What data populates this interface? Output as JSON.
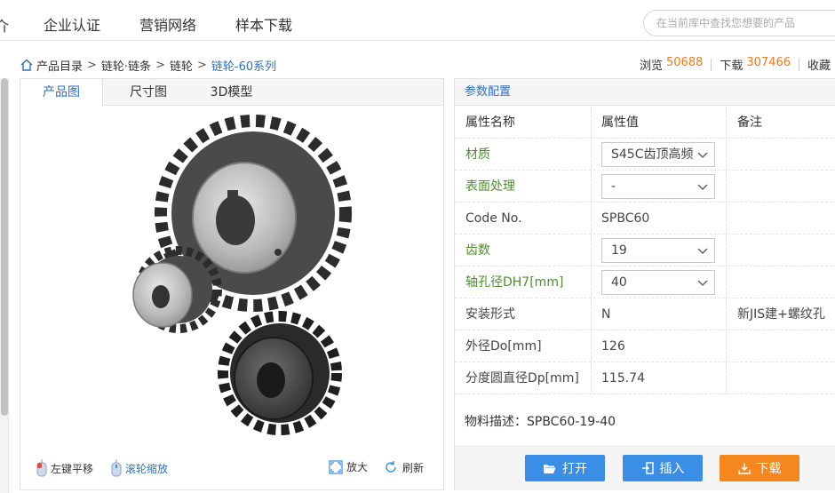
{
  "topnav": {
    "edge_text": "介",
    "items": [
      "企业认证",
      "营销网络",
      "样本下载"
    ],
    "search_placeholder": "在当前库中查找您想要的产品"
  },
  "breadcrumb": {
    "items": [
      "产品目录",
      "链轮·链条",
      "链轮",
      "链轮-60系列"
    ],
    "separator": ">"
  },
  "stats": {
    "views_label": "浏览",
    "views": "50688",
    "downloads_label": "下载",
    "downloads": "307466",
    "favorite_label": "收藏"
  },
  "image_panel": {
    "tabs": [
      "产品图",
      "尺寸图",
      "3D模型"
    ],
    "active_tab": 0,
    "tools": {
      "pan_label": "左键平移",
      "zoom_wheel_label": "滚轮缩放",
      "enlarge_label": "放大",
      "refresh_label": "刷新"
    }
  },
  "params": {
    "title": "参数配置",
    "columns": [
      "属性名称",
      "属性值",
      "备注"
    ],
    "rows": [
      {
        "name": "材质",
        "value": "S45C齿顶高频",
        "note": "",
        "select": true
      },
      {
        "name": "表面处理",
        "value": "-",
        "note": "",
        "select": true
      },
      {
        "name": "Code No.",
        "value": "SPBC60",
        "note": "",
        "select": false
      },
      {
        "name": "齿数",
        "value": "19",
        "note": "",
        "select": true
      },
      {
        "name": "轴孔径DH7[mm]",
        "value": "40",
        "note": "",
        "select": true
      },
      {
        "name": "安装形式",
        "value": "N",
        "note": "新JIS建+螺纹孔",
        "select": false
      },
      {
        "name": "外径Do[mm]",
        "value": "126",
        "note": "",
        "select": false
      },
      {
        "name": "分度圆直径Dp[mm]",
        "value": "115.74",
        "note": "",
        "select": false
      }
    ],
    "description": "物料描述：SPBC60-19-40",
    "buttons": {
      "open": "打开",
      "insert": "插入",
      "download": "下载"
    }
  },
  "colors": {
    "accent_blue": "#3a8ee6",
    "download_orange": "#f5871f",
    "stat_number": "#f07a1a",
    "selectable_label_green": "#4b8f2c"
  }
}
